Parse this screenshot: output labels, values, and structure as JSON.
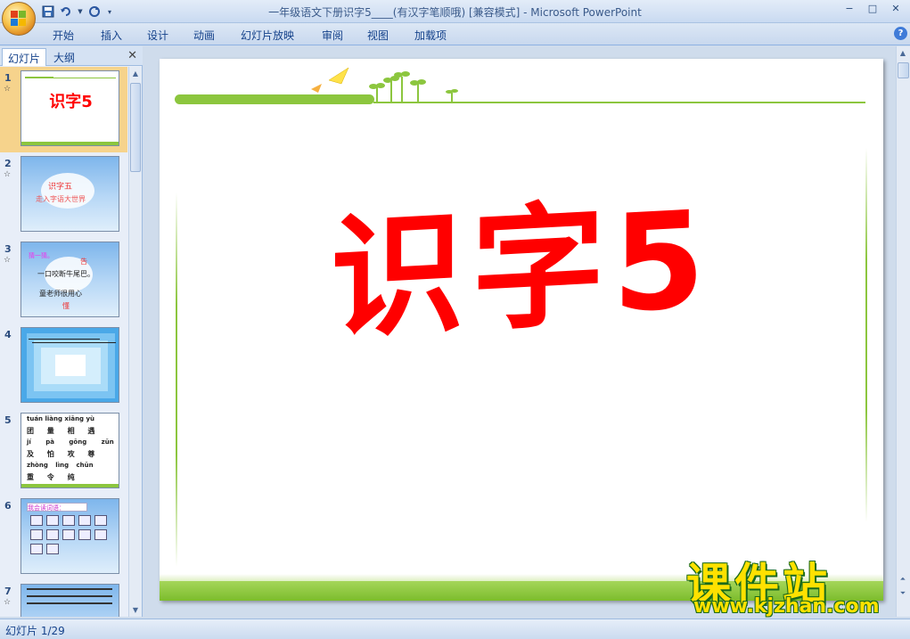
{
  "window": {
    "title": "一年级语文下册识字5____(有汉字笔顺哦) [兼容模式] - Microsoft PowerPoint",
    "minimize": "−",
    "maximize": "□",
    "close": "✕"
  },
  "ribbon": {
    "tabs": [
      "开始",
      "插入",
      "设计",
      "动画",
      "幻灯片放映",
      "审阅",
      "视图",
      "加载项"
    ],
    "help": "?"
  },
  "left_panel": {
    "tabs": [
      "幻灯片",
      "大纲"
    ],
    "close": "✕",
    "slides": [
      {
        "num": "1",
        "title": "识字5"
      },
      {
        "num": "2",
        "line1": "识字五",
        "line2": "走入字语大世界"
      },
      {
        "num": "3",
        "line1": "猜一猜。",
        "line2": "告",
        "line3": "一口咬断牛尾巴。",
        "line4": "童老师很用心",
        "line5": "懂"
      },
      {
        "num": "4"
      },
      {
        "num": "5",
        "rows": [
          "tuán liàng xiāng yù",
          "团 量 相 遇",
          "jí pà gōng zūn",
          "及 怕 攻 尊",
          "zhòng lìng chūn",
          "重 令 纯"
        ]
      },
      {
        "num": "6",
        "header": "我会读词语："
      },
      {
        "num": "7"
      }
    ]
  },
  "slide": {
    "title": "识字5"
  },
  "watermark": {
    "brand": "课件站",
    "url": "www.kjzhan.com"
  },
  "status": {
    "text": "幻灯片 1/29"
  },
  "colors": {
    "accent_red": "#ff0000",
    "green": "#8cc63e",
    "selected": "#f6d38c"
  }
}
